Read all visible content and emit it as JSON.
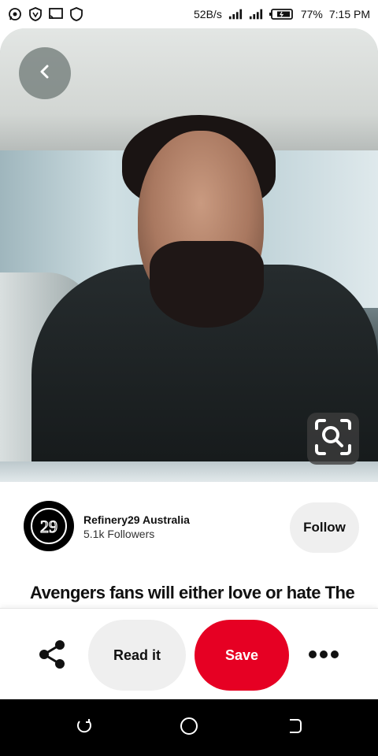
{
  "status_bar": {
    "speed": "52B/s",
    "battery": "77%",
    "time": "7:15 PM",
    "icons": [
      "whatsapp-icon",
      "shield-v-icon",
      "cast-icon",
      "shield-icon",
      "signal-icon",
      "signal-4g-icon",
      "battery-icon"
    ]
  },
  "pin": {
    "image_alt": "",
    "back_icon": "chevron-left-icon",
    "visual_search_icon": "lens-search-icon"
  },
  "creator": {
    "name": "Refinery29 Australia",
    "followers": "5.1k Followers",
    "follow_label": "Follow",
    "avatar_text": "29"
  },
  "title": "Avengers fans will either love or hate The",
  "actions": {
    "share_icon": "share-icon",
    "read_label": "Read it",
    "save_label": "Save",
    "more_icon": "more-horizontal-icon"
  },
  "colors": {
    "save_red": "#e60023",
    "pill_gray": "#efefef"
  },
  "nav": {
    "icons": [
      "recents-icon",
      "home-icon",
      "back-icon"
    ]
  }
}
